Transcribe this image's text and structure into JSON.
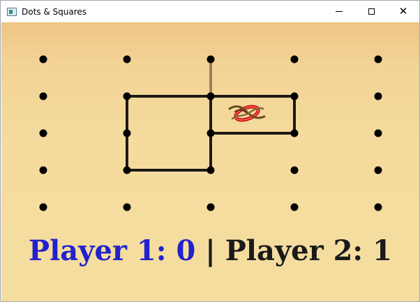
{
  "window": {
    "title": "Dots & Squares",
    "controls": [
      "minimize",
      "maximize",
      "close"
    ]
  },
  "board": {
    "rows": 5,
    "cols": 5,
    "colors": {
      "line": "#1c1a16",
      "pending_line": "#9a8257",
      "dot": "#000000"
    },
    "drawn_lines": [
      {
        "from": [
          1,
          1
        ],
        "to": [
          1,
          2
        ]
      },
      {
        "from": [
          1,
          2
        ],
        "to": [
          1,
          3
        ]
      },
      {
        "from": [
          1,
          1
        ],
        "to": [
          3,
          1
        ]
      },
      {
        "from": [
          3,
          1
        ],
        "to": [
          3,
          2
        ]
      },
      {
        "from": [
          1,
          2
        ],
        "to": [
          3,
          2
        ]
      },
      {
        "from": [
          2,
          2
        ],
        "to": [
          2,
          3
        ]
      },
      {
        "from": [
          1,
          3
        ],
        "to": [
          2,
          3
        ]
      }
    ],
    "pending_line": {
      "from": [
        0,
        2
      ],
      "to": [
        1,
        2
      ]
    },
    "claimed_box": {
      "row": 1,
      "col": 2,
      "marker": "swirl-logo"
    }
  },
  "score": {
    "player1_label": "Player 1: 0",
    "separator": "|",
    "player2_label": "Player 2: 1",
    "player1_color": "#2222cc",
    "player2_color": "#1a1a1a"
  }
}
